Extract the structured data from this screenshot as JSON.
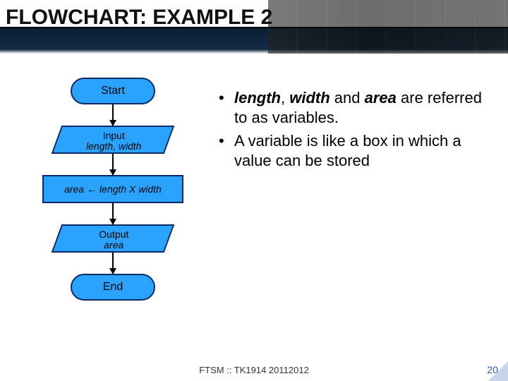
{
  "title": "FLOWCHART: EXAMPLE 2",
  "flow": {
    "start": "Start",
    "input_label": "Input",
    "input_vars": "length, width",
    "process": "area ← length X width",
    "output_label": "Output",
    "output_var": "area",
    "end": "End"
  },
  "bullets": {
    "b1_emph1": "length",
    "b1_mid": ", ",
    "b1_emph2": "width",
    "b1_text1": " and ",
    "b1_emph3": "area",
    "b1_text2": " are referred to as variables.",
    "b2": "A variable is like a box in which a value can be stored"
  },
  "footer": "FTSM :: TK1914 20112012",
  "page": "20"
}
